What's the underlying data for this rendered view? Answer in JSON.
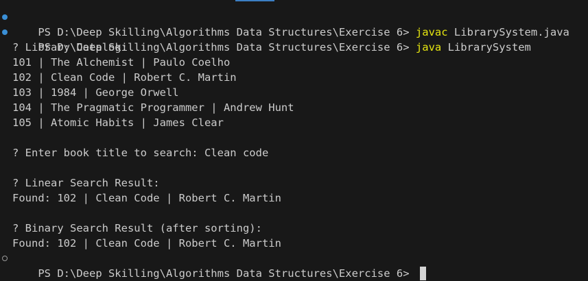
{
  "accent_color": "#3b7fc4",
  "prompt": "PS D:\\Deep Skilling\\Algorithms Data Structures\\Exercise 6> ",
  "commands": [
    {
      "cmd": "javac",
      "args": " LibrarySystem.java"
    },
    {
      "cmd": "java",
      "args": " LibrarySystem"
    }
  ],
  "catalog_header": "? Library Catalog:",
  "catalog": [
    "101 | The Alchemist | Paulo Coelho",
    "102 | Clean Code | Robert C. Martin",
    "103 | 1984 | George Orwell",
    "104 | The Pragmatic Programmer | Andrew Hunt",
    "105 | Atomic Habits | James Clear"
  ],
  "search_prompt": "? Enter book title to search: Clean code",
  "linear_header": "? Linear Search Result:",
  "linear_result": "Found: 102 | Clean Code | Robert C. Martin",
  "binary_header": "? Binary Search Result (after sorting):",
  "binary_result": "Found: 102 | Clean Code | Robert C. Martin",
  "status_colors": {
    "done": "#3a8fd6",
    "pending": "#9a9a9a",
    "command": "#e5e510"
  }
}
